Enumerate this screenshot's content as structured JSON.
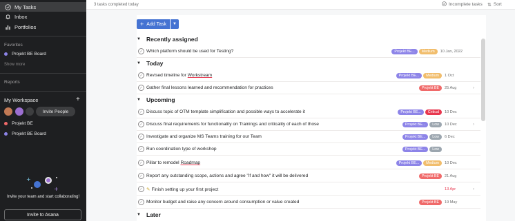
{
  "sidebar": {
    "nav": [
      {
        "label": "My Tasks",
        "icon": "check-circle-icon"
      },
      {
        "label": "Inbox",
        "icon": "bell-icon"
      },
      {
        "label": "Portfolios",
        "icon": "bar-chart-icon"
      }
    ],
    "favorites_label": "Favorites",
    "favorites": [
      {
        "label": "Projekt BE Board",
        "color": "#8d84e8"
      }
    ],
    "show_more": "Show more",
    "reports_label": "Reports",
    "workspace_label": "My Workspace",
    "invite_pill": "Invite People",
    "projects": [
      {
        "label": "Projekt BE",
        "color": "#f06a6a"
      },
      {
        "label": "Projekt BE Board",
        "color": "#8d84e8"
      }
    ],
    "promo_text": "Invite your team and start collaborating!",
    "invite_button": "Invite to Asana"
  },
  "topbar": {
    "completed": "3 tasks completed today",
    "incomplete": "Incomplete tasks",
    "sort": "Sort"
  },
  "toolbar": {
    "add_task": "Add Task"
  },
  "colors": {
    "tag_project": "#8d84e8",
    "tag_project_red": "#f06a6a",
    "medium": "#f1bd6c",
    "critical": "#e8384f",
    "low": "#9ca6af"
  },
  "sections": [
    {
      "title": "Recently assigned"
    },
    {
      "title": "Today"
    },
    {
      "title": "Upcoming"
    },
    {
      "title": "Later"
    }
  ],
  "tasks": [
    {
      "title": "Which platform should be used for Testing?",
      "project": "Projekt BE...",
      "priority": "Medium",
      "due": "10 Jan, 2022"
    },
    {
      "title_prefix": "Revised timeline for ",
      "title_link": "Workstream",
      "project": "Projekt BE...",
      "priority": "Medium",
      "due": "1 Oct"
    },
    {
      "title": "Gather final lessons learned and recommendation for practices",
      "project": "Projekt BE",
      "due": "25 Aug"
    },
    {
      "title": "Discuss topic of OTM template simplification and possible ways to accelerate it",
      "project": "Projekt BE...",
      "priority": "Critical",
      "due": "10 Dec"
    },
    {
      "title": "Discuss final requirements for functionality on Trainings and criticality of each of those",
      "project": "Projekt BE...",
      "priority": "Low",
      "due": "10 Dec"
    },
    {
      "title": "Investigate and organize MS Teams training for our Team",
      "project": "Projekt BE...",
      "priority": "Low",
      "due": "6 Dec"
    },
    {
      "title": "Run coordination type of workshop",
      "project": "Projekt BE...",
      "priority": "Low",
      "due": ""
    },
    {
      "title_prefix": "Pillar to remodel ",
      "title_link": "Roadmap",
      "project": "Projekt BE...",
      "priority": "Medium",
      "due": "10 Dec"
    },
    {
      "title": "Report any outstanding scope, actions and agree \"if and how\" it will be delivered",
      "project": "Projekt BE",
      "due": "21 Aug"
    },
    {
      "title": "Finish setting up your first project",
      "icon": "pencil-icon",
      "due": "13 Apr"
    },
    {
      "title": "Monitor budget and raise any concern around consumption or value created",
      "project": "Projekt BE",
      "due": "19 May"
    }
  ]
}
